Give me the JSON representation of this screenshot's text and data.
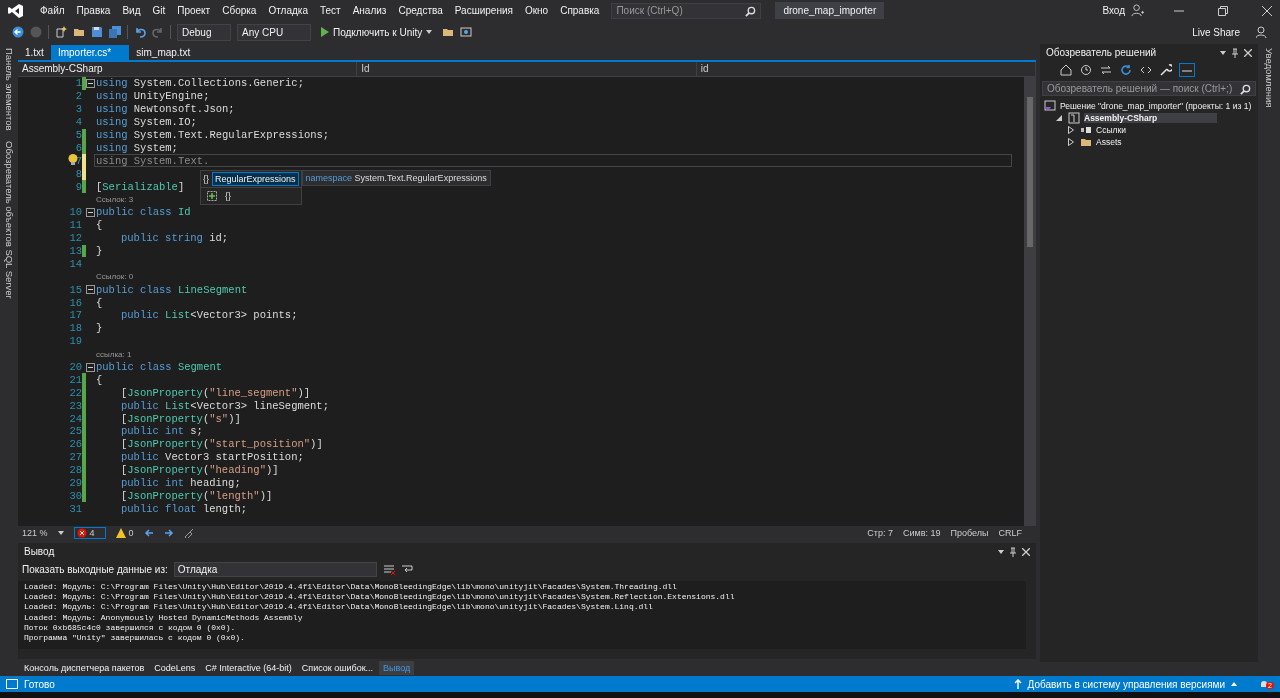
{
  "title_bar": {
    "menu": [
      "Файл",
      "Правка",
      "Вид",
      "Git",
      "Проект",
      "Сборка",
      "Отладка",
      "Тест",
      "Анализ",
      "Средства",
      "Расширения",
      "Окно",
      "Справка"
    ],
    "search": {
      "placeholder": "Поиск (Ctrl+Q)"
    },
    "solution_name": "drone_map_importer",
    "sign_in": "Вход"
  },
  "toolbar": {
    "configuration": "Debug",
    "platform": "Any CPU",
    "run_button": "Подключить к Unity",
    "live_share": "Live Share"
  },
  "left_strip": [
    "Панель элементов",
    "Обозреватель объектов SQL Server"
  ],
  "right_strip": [
    "Уведомления"
  ],
  "tabs": [
    {
      "label": "1.txt",
      "selected": false
    },
    {
      "label": "Importer.cs*",
      "selected": true
    },
    {
      "label": "sim_map.txt",
      "selected": false
    }
  ],
  "nav_bar": [
    "Assembly-CSharp",
    "Id",
    "id"
  ],
  "code_lines": [
    {
      "number": "1",
      "fold": true,
      "changed": true,
      "saved": true,
      "tokens": [
        {
          "kind": "keyword",
          "text": "using"
        },
        {
          "kind": "plain",
          "text": " System.Collections.Generic;"
        }
      ]
    },
    {
      "number": "2",
      "changed": false,
      "tokens": [
        {
          "kind": "keyword",
          "text": "using"
        },
        {
          "kind": "plain",
          "text": " UnityEngine;"
        }
      ]
    },
    {
      "number": "3",
      "changed": false,
      "tokens": [
        {
          "kind": "keyword",
          "text": "using"
        },
        {
          "kind": "plain",
          "text": " Newtonsoft.Json;"
        }
      ]
    },
    {
      "number": "4",
      "changed": false,
      "tokens": [
        {
          "kind": "keyword",
          "text": "using"
        },
        {
          "kind": "plain",
          "text": " System.IO;"
        }
      ]
    },
    {
      "number": "5",
      "changed": true,
      "saved": true,
      "tokens": [
        {
          "kind": "keyword",
          "text": "using"
        },
        {
          "kind": "plain",
          "text": " System.Text.RegularExpressions;"
        }
      ]
    },
    {
      "number": "6",
      "changed": true,
      "saved": true,
      "tokens": [
        {
          "kind": "keyword",
          "text": "using"
        },
        {
          "kind": "plain",
          "text": " System;"
        }
      ]
    },
    {
      "number": "7",
      "changed": true,
      "saved": false,
      "current": true,
      "lightbulb": true,
      "tokens": [
        {
          "kind": "faded",
          "text": "using System.Text."
        }
      ]
    },
    {
      "number": "8",
      "changed": true,
      "saved": false
    },
    {
      "number": "9",
      "changed": true,
      "saved": true,
      "tokens": [
        {
          "kind": "plain",
          "text": "["
        },
        {
          "kind": "type",
          "text": "Serializable"
        },
        {
          "kind": "plain",
          "text": "]"
        }
      ]
    },
    {
      "number": "10",
      "fold": true,
      "changed": false,
      "codelens": "Ссылок: 3",
      "tokens": [
        {
          "kind": "keyword",
          "text": "public class"
        },
        {
          "kind": "type",
          "text": " Id"
        }
      ]
    },
    {
      "number": "11",
      "changed": false,
      "tokens": [
        {
          "kind": "plain",
          "text": "{"
        }
      ]
    },
    {
      "number": "12",
      "changed": false,
      "indented": true,
      "tokens": [
        {
          "kind": "keyword",
          "text": "public string"
        },
        {
          "kind": "plain",
          "text": " id;"
        }
      ]
    },
    {
      "number": "13",
      "changed": true,
      "saved": true,
      "tokens": [
        {
          "kind": "plain",
          "text": "}"
        }
      ]
    },
    {
      "number": "14",
      "changed": false
    },
    {
      "number": "15",
      "fold": true,
      "changed": false,
      "codelens": "Ссылок: 0",
      "tokens": [
        {
          "kind": "keyword",
          "text": "public class"
        },
        {
          "kind": "type",
          "text": " LineSegment"
        }
      ]
    },
    {
      "number": "16",
      "changed": false,
      "tokens": [
        {
          "kind": "plain",
          "text": "{"
        }
      ]
    },
    {
      "number": "17",
      "changed": false,
      "indented": true,
      "tokens": [
        {
          "kind": "keyword",
          "text": "public"
        },
        {
          "kind": "type",
          "text": " List"
        },
        {
          "kind": "plain",
          "text": "<Vector3> points;"
        }
      ]
    },
    {
      "number": "18",
      "changed": false,
      "tokens": [
        {
          "kind": "plain",
          "text": "}"
        }
      ]
    },
    {
      "number": "19",
      "changed": false
    },
    {
      "number": "20",
      "fold": true,
      "changed": false,
      "codelens": "ссылка: 1",
      "tokens": [
        {
          "kind": "keyword",
          "text": "public class"
        },
        {
          "kind": "type",
          "text": " Segment"
        }
      ]
    },
    {
      "number": "21",
      "changed": true,
      "saved": true,
      "tokens": [
        {
          "kind": "plain",
          "text": "{"
        }
      ]
    },
    {
      "number": "22",
      "changed": true,
      "saved": true,
      "indented": true,
      "tokens": [
        {
          "kind": "plain",
          "text": "["
        },
        {
          "kind": "type",
          "text": "JsonProperty"
        },
        {
          "kind": "plain",
          "text": "("
        },
        {
          "kind": "string",
          "text": "\"line_segment\""
        },
        {
          "kind": "plain",
          "text": ")]"
        }
      ]
    },
    {
      "number": "23",
      "changed": true,
      "saved": true,
      "indented": true,
      "tokens": [
        {
          "kind": "keyword",
          "text": "public"
        },
        {
          "kind": "type",
          "text": " List"
        },
        {
          "kind": "plain",
          "text": "<Vector3> lineSegment;"
        }
      ]
    },
    {
      "number": "24",
      "changed": true,
      "saved": true,
      "indented": true,
      "tokens": [
        {
          "kind": "plain",
          "text": "["
        },
        {
          "kind": "type",
          "text": "JsonProperty"
        },
        {
          "kind": "plain",
          "text": "("
        },
        {
          "kind": "string",
          "text": "\"s\""
        },
        {
          "kind": "plain",
          "text": ")]"
        }
      ]
    },
    {
      "number": "25",
      "changed": true,
      "saved": true,
      "indented": true,
      "tokens": [
        {
          "kind": "keyword",
          "text": "public int"
        },
        {
          "kind": "plain",
          "text": " s;"
        }
      ]
    },
    {
      "number": "26",
      "changed": true,
      "saved": true,
      "indented": true,
      "tokens": [
        {
          "kind": "plain",
          "text": "["
        },
        {
          "kind": "type",
          "text": "JsonProperty"
        },
        {
          "kind": "plain",
          "text": "("
        },
        {
          "kind": "string",
          "text": "\"start_position\""
        },
        {
          "kind": "plain",
          "text": ")]"
        }
      ]
    },
    {
      "number": "27",
      "changed": true,
      "saved": true,
      "indented": true,
      "tokens": [
        {
          "kind": "keyword",
          "text": "public"
        },
        {
          "kind": "plain",
          "text": " Vector3 startPosition;"
        }
      ]
    },
    {
      "number": "28",
      "changed": true,
      "saved": true,
      "indented": true,
      "tokens": [
        {
          "kind": "plain",
          "text": "["
        },
        {
          "kind": "type",
          "text": "JsonProperty"
        },
        {
          "kind": "plain",
          "text": "("
        },
        {
          "kind": "string",
          "text": "\"heading\""
        },
        {
          "kind": "plain",
          "text": ")]"
        }
      ]
    },
    {
      "number": "29",
      "changed": true,
      "saved": true,
      "indented": true,
      "tokens": [
        {
          "kind": "keyword",
          "text": "public int"
        },
        {
          "kind": "plain",
          "text": " heading;"
        }
      ]
    },
    {
      "number": "30",
      "changed": true,
      "saved": true,
      "indented": true,
      "tokens": [
        {
          "kind": "plain",
          "text": "["
        },
        {
          "kind": "type",
          "text": "JsonProperty"
        },
        {
          "kind": "plain",
          "text": "("
        },
        {
          "kind": "string",
          "text": "\"length\""
        },
        {
          "kind": "plain",
          "text": ")]"
        }
      ]
    },
    {
      "number": "31",
      "changed": false,
      "indented": true,
      "tokens": [
        {
          "kind": "keyword",
          "text": "public float"
        },
        {
          "kind": "plain",
          "text": " length;"
        }
      ]
    }
  ],
  "completion": {
    "items": [
      {
        "glyph": "{}",
        "label": "RegularExpressions",
        "selected": true
      }
    ],
    "tooltip": {
      "kind": "namespace",
      "name": "System.Text.RegularExpressions"
    },
    "filters": [
      "{}"
    ]
  },
  "editor_status": {
    "zoom": "121 %",
    "errors": "4",
    "warnings": "0",
    "line": "Стр: 7",
    "column": "Симв: 19",
    "indent": "Пробелы",
    "line_endings": "CRLF"
  },
  "output": {
    "title": "Вывод",
    "source_label": "Показать выходные данные из:",
    "source": "Отладка",
    "lines": [
      "Loaded: Модуль: C:\\Program Files\\Unity\\Hub\\Editor\\2019.4.4f1\\Editor\\Data\\MonoBleedingEdge\\lib\\mono\\unityjit\\Facades\\System.Threading.dll",
      "Loaded: Модуль: C:\\Program Files\\Unity\\Hub\\Editor\\2019.4.4f1\\Editor\\Data\\MonoBleedingEdge\\lib\\mono\\unityjit\\Facades\\System.Reflection.Extensions.dll",
      "Loaded: Модуль: C:\\Program Files\\Unity\\Hub\\Editor\\2019.4.4f1\\Editor\\Data\\MonoBleedingEdge\\lib\\mono\\unityjit\\Facades\\System.Linq.dll",
      "Loaded: Модуль: Anonymously Hosted DynamicMethods Assembly",
      "Поток 0xb685c4c0 завершился с кодом 0 (0x0).",
      "Программа \"Unity\" завершилась с кодом 0 (0x0)."
    ]
  },
  "bottom_tabs": [
    {
      "label": "Консоль диспетчера пакетов",
      "selected": false
    },
    {
      "label": "CodeLens",
      "selected": false
    },
    {
      "label": "C# Interactive (64-bit)",
      "selected": false
    },
    {
      "label": "Список ошибок...",
      "selected": false
    },
    {
      "label": "Вывод",
      "selected": true
    }
  ],
  "solution_explorer": {
    "title": "Обозреватель решений",
    "search": {
      "placeholder": "Обозреватель решений — поиск (Ctrl+;)"
    },
    "tree": [
      {
        "label": "Решение \"drone_map_importer\" (проекты: 1 из 1)",
        "kind": "solution",
        "selected": false,
        "expanded": true,
        "children": [
          {
            "label": "Assembly-CSharp",
            "kind": "project",
            "selected": true,
            "expanded": true,
            "children": [
              {
                "label": "Ссылки",
                "kind": "references",
                "selected": false,
                "expanded": false
              },
              {
                "label": "Assets",
                "kind": "folder",
                "selected": false,
                "expanded": false
              }
            ]
          }
        ]
      }
    ]
  },
  "status_bar": {
    "state": "Готово",
    "source_control": "Добавить в систему управления версиями",
    "notifications": "2"
  }
}
